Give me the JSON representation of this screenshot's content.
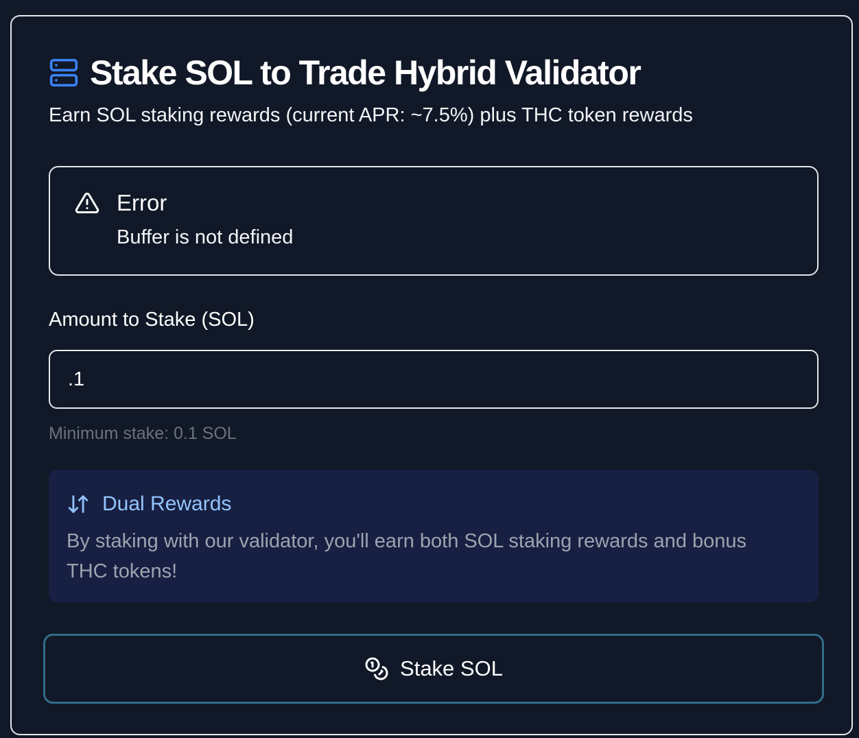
{
  "header": {
    "title": "Stake SOL to Trade Hybrid Validator",
    "subtitle": "Earn SOL staking rewards (current APR: ~7.5%) plus THC token rewards",
    "icon": "server-icon",
    "icon_color": "#3b82f6"
  },
  "error": {
    "icon": "alert-triangle-icon",
    "title": "Error",
    "message": "Buffer is not defined"
  },
  "form": {
    "amount_label": "Amount to Stake (SOL)",
    "amount_value": ".1",
    "hint": "Minimum stake: 0.1 SOL"
  },
  "rewards": {
    "icon": "arrow-up-down-icon",
    "title": "Dual Rewards",
    "text": "By staking with our validator, you'll earn both SOL staking rewards and bonus THC tokens!",
    "title_color": "#93c5fd",
    "background": "#172042"
  },
  "action": {
    "icon": "coins-icon",
    "label": "Stake SOL",
    "border_color": "#2f6f8a"
  }
}
